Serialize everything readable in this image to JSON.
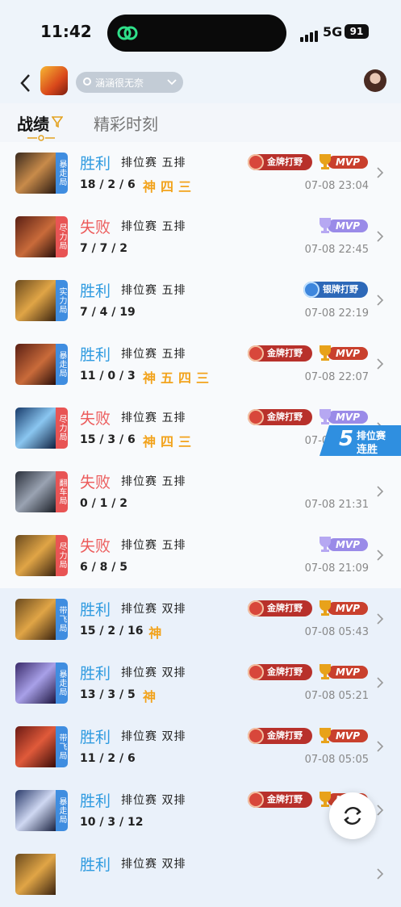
{
  "status": {
    "time": "11:42",
    "network": "5G",
    "battery": "91"
  },
  "header": {
    "account_name": "涵涵很无奈"
  },
  "tabs": {
    "record": "战绩",
    "highlights": "精彩时刻"
  },
  "streak": {
    "number": "5",
    "line1": "排位赛",
    "line2": "连胜"
  },
  "colors": {
    "win": "#2f9be0",
    "loss": "#ec5c5c",
    "gold_badge": "#b8312b",
    "silver_badge": "#2d68b8",
    "mvp_gold": "#c9402d",
    "mvp_purple": "#9a8be8"
  },
  "matches": [
    {
      "result": "胜利",
      "win": true,
      "mode": "排位赛",
      "party": "五排",
      "kda": "18 / 2 / 6",
      "tag": "暴走局",
      "tag_color": "#3f8de0",
      "badges": [
        "神",
        "四",
        "三"
      ],
      "medal": "金牌打野",
      "mvp": "MVP",
      "mvp_color": "gold",
      "date": "07-08 23:04"
    },
    {
      "result": "失败",
      "win": false,
      "mode": "排位赛",
      "party": "五排",
      "kda": "7 / 7 / 2",
      "tag": "尽力局",
      "tag_color": "#e85454",
      "badges": [],
      "medal": "",
      "mvp": "MVP",
      "mvp_color": "purple",
      "date": "07-08 22:45"
    },
    {
      "result": "胜利",
      "win": true,
      "mode": "排位赛",
      "party": "五排",
      "kda": "7 / 4 / 19",
      "tag": "实力局",
      "tag_color": "#3f8de0",
      "badges": [],
      "medal": "银牌打野",
      "mvp": "",
      "mvp_color": "",
      "date": "07-08 22:19"
    },
    {
      "result": "胜利",
      "win": true,
      "mode": "排位赛",
      "party": "五排",
      "kda": "11 / 0 / 3",
      "tag": "暴走局",
      "tag_color": "#3f8de0",
      "badges": [
        "神",
        "五",
        "四",
        "三"
      ],
      "medal": "金牌打野",
      "mvp": "MVP",
      "mvp_color": "gold",
      "date": "07-08 22:07"
    },
    {
      "result": "失败",
      "win": false,
      "mode": "排位赛",
      "party": "五排",
      "kda": "15 / 3 / 6",
      "tag": "尽力局",
      "tag_color": "#e85454",
      "badges": [
        "神",
        "四",
        "三"
      ],
      "medal": "金牌打野",
      "mvp": "MVP",
      "mvp_color": "purple",
      "date": "07-08 21:42"
    },
    {
      "result": "失败",
      "win": false,
      "mode": "排位赛",
      "party": "五排",
      "kda": "0 / 1 / 2",
      "tag": "翻车局",
      "tag_color": "#e85454",
      "badges": [],
      "medal": "",
      "mvp": "",
      "mvp_color": "",
      "date": "07-08 21:31"
    },
    {
      "result": "失败",
      "win": false,
      "mode": "排位赛",
      "party": "五排",
      "kda": "6 / 8 / 5",
      "tag": "尽力局",
      "tag_color": "#e85454",
      "badges": [],
      "medal": "",
      "mvp": "MVP",
      "mvp_color": "purple",
      "date": "07-08 21:09"
    },
    {
      "result": "胜利",
      "win": true,
      "mode": "排位赛",
      "party": "双排",
      "kda": "15 / 2 / 16",
      "tag": "带飞局",
      "tag_color": "#3f8de0",
      "badges": [
        "神"
      ],
      "medal": "金牌打野",
      "mvp": "MVP",
      "mvp_color": "gold",
      "date": "07-08 05:43"
    },
    {
      "result": "胜利",
      "win": true,
      "mode": "排位赛",
      "party": "双排",
      "kda": "13 / 3 / 5",
      "tag": "暴走局",
      "tag_color": "#3f8de0",
      "badges": [
        "神"
      ],
      "medal": "金牌打野",
      "mvp": "MVP",
      "mvp_color": "gold",
      "date": "07-08 05:21"
    },
    {
      "result": "胜利",
      "win": true,
      "mode": "排位赛",
      "party": "双排",
      "kda": "11 / 2 / 6",
      "tag": "带飞局",
      "tag_color": "#3f8de0",
      "badges": [],
      "medal": "金牌打野",
      "mvp": "MVP",
      "mvp_color": "gold",
      "date": "07-08 05:05"
    },
    {
      "result": "胜利",
      "win": true,
      "mode": "排位赛",
      "party": "双排",
      "kda": "10 / 3 / 12",
      "tag": "暴走局",
      "tag_color": "#3f8de0",
      "badges": [],
      "medal": "金牌打野",
      "mvp": "MVP",
      "mvp_color": "gold",
      "date": "07-08"
    },
    {
      "result": "胜利",
      "win": true,
      "mode": "排位赛",
      "party": "双排",
      "kda": "",
      "tag": "",
      "tag_color": "#3f8de0",
      "badges": [],
      "medal": "",
      "mvp": "",
      "mvp_color": "",
      "date": ""
    }
  ]
}
